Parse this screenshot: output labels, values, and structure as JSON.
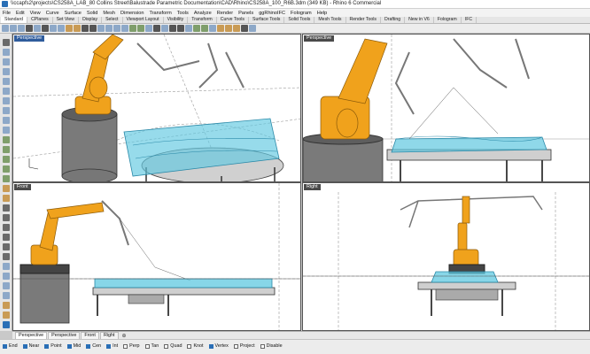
{
  "window": {
    "title": "\\\\ccapfs2\\projects\\CS258A_LAB_80 Collins Street\\Balustrade Parametric Documentation\\CAD\\Rhino\\CS258A_100_R6B.3dm (349 KB) - Rhino 6 Commercial"
  },
  "menu": [
    "File",
    "Edit",
    "View",
    "Curve",
    "Surface",
    "Solid",
    "Mesh",
    "Dimension",
    "Transform",
    "Tools",
    "Analyze",
    "Render",
    "Panels",
    "ggRhinoIFC",
    "Fologram",
    "Help"
  ],
  "toolbar_tabs": [
    {
      "label": "Standard",
      "active": true
    },
    {
      "label": "CPlanes"
    },
    {
      "label": "Set View"
    },
    {
      "label": "Display"
    },
    {
      "label": "Select"
    },
    {
      "label": "Viewport Layout"
    },
    {
      "label": "Visibility"
    },
    {
      "label": "Transform"
    },
    {
      "label": "Curve Tools"
    },
    {
      "label": "Surface Tools"
    },
    {
      "label": "Solid Tools"
    },
    {
      "label": "Mesh Tools"
    },
    {
      "label": "Render Tools"
    },
    {
      "label": "Drafting"
    },
    {
      "label": "New in V6"
    },
    {
      "label": "Fologram"
    },
    {
      "label": "IFC"
    }
  ],
  "toolbar_icons": [
    "new-icon",
    "open-icon",
    "save-icon",
    "print-icon",
    "import-icon",
    "cut-icon",
    "copy-icon",
    "paste-icon",
    "undo-icon",
    "redo-icon",
    "pan-icon",
    "rotate-icon",
    "zoom-icon",
    "zoom-window-icon",
    "zoom-extents-icon",
    "zoom-selected-icon",
    "four-views-icon",
    "cplane-icon",
    "layer-icon",
    "properties-icon",
    "display-mode-icon",
    "osnap-icon",
    "point-icon",
    "curve-icon",
    "surface-icon",
    "solid-icon",
    "mesh-icon",
    "render-icon",
    "material-icon",
    "light-icon",
    "options-icon",
    "help-icon"
  ],
  "viewports": [
    {
      "label": "Perspective",
      "active": true
    },
    {
      "label": "Perspective",
      "active": false
    },
    {
      "label": "Front",
      "active": false
    },
    {
      "label": "Right",
      "active": false
    }
  ],
  "viewport_tabs": [
    {
      "label": "Perspective",
      "active": true
    },
    {
      "label": "Perspective"
    },
    {
      "label": "Front"
    },
    {
      "label": "Right"
    }
  ],
  "osnaps": [
    {
      "label": "End",
      "on": true
    },
    {
      "label": "Near",
      "on": true
    },
    {
      "label": "Point",
      "on": true
    },
    {
      "label": "Mid",
      "on": true
    },
    {
      "label": "Cen",
      "on": true
    },
    {
      "label": "Int",
      "on": true
    },
    {
      "label": "Perp",
      "on": false
    },
    {
      "label": "Tan",
      "on": false
    },
    {
      "label": "Quad",
      "on": false
    },
    {
      "label": "Knot",
      "on": false
    },
    {
      "label": "Vertex",
      "on": true
    },
    {
      "label": "Project",
      "on": false
    },
    {
      "label": "Disable",
      "on": false
    }
  ],
  "colors": {
    "robot": "#f0a21c",
    "glass": "#5fc8e0",
    "grid": "#9a9a9a",
    "active_label": "#2f5c9c"
  }
}
